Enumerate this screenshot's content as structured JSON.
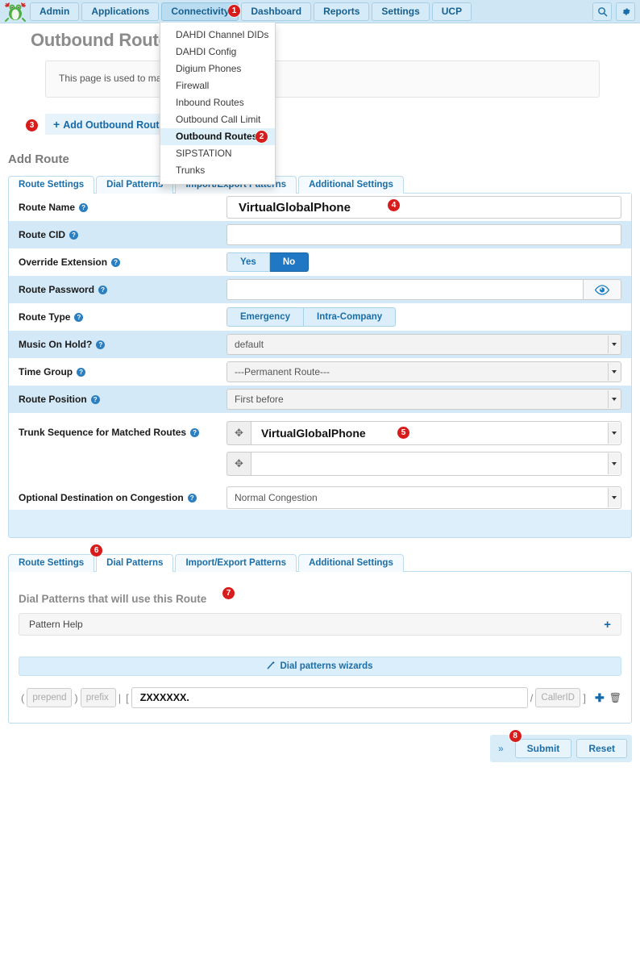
{
  "navbar": {
    "logo_name": "freepbx-frog-logo",
    "items": [
      {
        "label": "Admin",
        "active": false
      },
      {
        "label": "Applications",
        "active": false
      },
      {
        "label": "Connectivity",
        "active": true
      },
      {
        "label": "Dashboard",
        "active": false
      },
      {
        "label": "Reports",
        "active": false
      },
      {
        "label": "Settings",
        "active": false
      },
      {
        "label": "UCP",
        "active": false
      }
    ],
    "search_icon": "search-icon",
    "gear_icon": "gear-icon"
  },
  "dropdown": {
    "items": [
      {
        "label": "DAHDI Channel DIDs",
        "selected": false
      },
      {
        "label": "DAHDI Config",
        "selected": false
      },
      {
        "label": "Digium Phones",
        "selected": false
      },
      {
        "label": "Firewall",
        "selected": false
      },
      {
        "label": "Inbound Routes",
        "selected": false
      },
      {
        "label": "Outbound Call Limit",
        "selected": false
      },
      {
        "label": "Outbound Routes",
        "selected": true
      },
      {
        "label": "SIPSTATION",
        "selected": false
      },
      {
        "label": "Trunks",
        "selected": false
      }
    ]
  },
  "header": {
    "page_title": "Outbound Routes",
    "description": "This page is used to manag",
    "add_route_label": "Add Outbound Route",
    "add_route_plus": "+",
    "section_title": "Add Route"
  },
  "tabs_top": [
    {
      "label": "Route Settings",
      "active": true
    },
    {
      "label": "Dial Patterns",
      "active": false
    },
    {
      "label": "Import/Export Patterns",
      "active": false
    },
    {
      "label": "Additional Settings",
      "active": false
    }
  ],
  "route_settings": {
    "route_name": {
      "label": "Route Name",
      "value": "VirtualGlobalPhone"
    },
    "route_cid": {
      "label": "Route CID",
      "value": "",
      "placeholder": ""
    },
    "override_extension": {
      "label": "Override Extension",
      "options": [
        "Yes",
        "No"
      ],
      "selected": "No"
    },
    "route_password": {
      "label": "Route Password",
      "value": "",
      "eye_icon": "eye-icon"
    },
    "route_type": {
      "label": "Route Type",
      "options": [
        "Emergency",
        "Intra-Company"
      ],
      "selected": ""
    },
    "music_on_hold": {
      "label": "Music On Hold?",
      "value": "default"
    },
    "time_group": {
      "label": "Time Group",
      "value": "---Permanent Route---"
    },
    "route_position": {
      "label": "Route Position",
      "value": "First before"
    },
    "trunk_sequence": {
      "label": "Trunk Sequence for Matched Routes",
      "rows": [
        {
          "value": "VirtualGlobalPhone"
        },
        {
          "value": ""
        }
      ]
    },
    "optional_destination": {
      "label": "Optional Destination on Congestion",
      "value": "Normal Congestion"
    }
  },
  "tabs_bottom": [
    {
      "label": "Route Settings",
      "active": false
    },
    {
      "label": "Dial Patterns",
      "active": true
    },
    {
      "label": "Import/Export Patterns",
      "active": false
    },
    {
      "label": "Additional Settings",
      "active": false
    }
  ],
  "dial_patterns": {
    "title": "Dial Patterns that will use this Route",
    "pattern_help_label": "Pattern Help",
    "pattern_help_plus": "+",
    "wizard_label": "Dial patterns wizards",
    "wizard_icon": "wand-icon",
    "row": {
      "prepend_placeholder": "prepend",
      "prepend_value": "",
      "prefix_placeholder": "prefix",
      "prefix_value": "",
      "match_pattern_value": "ZXXXXXX.",
      "callerid_placeholder": "CallerID",
      "callerid_value": "",
      "bracket_open": "(",
      "bracket_close": ")",
      "pipe": "|",
      "sq_open": "[",
      "sq_close": "]",
      "slash": "/",
      "add_icon": "plus-icon",
      "delete_icon": "trash-icon"
    }
  },
  "footer": {
    "chevron": "»",
    "submit_label": "Submit",
    "reset_label": "Reset"
  },
  "badges": {
    "b1": "1",
    "b2": "2",
    "b3": "3",
    "b4": "4",
    "b5": "5",
    "b6": "6",
    "b7": "7",
    "b8": "8"
  },
  "colors": {
    "accent": "#1b6ea8",
    "navbar_bg": "#cfe7f5",
    "row_alt": "#d3e9f7",
    "badge_red": "#d81c1c",
    "toggle_on": "#2077c4"
  }
}
